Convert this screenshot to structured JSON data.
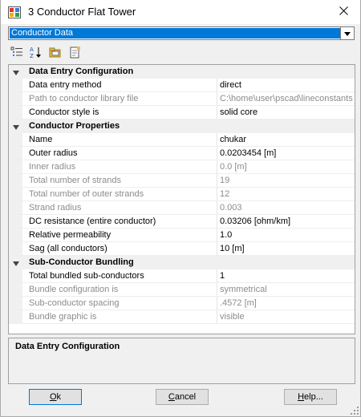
{
  "window": {
    "title": "3 Conductor Flat Tower",
    "colors": {
      "selection": "#0078d7",
      "category_bg": "#f0f0f0",
      "disabled_text": "#8c8c8c"
    }
  },
  "dropdown": {
    "selected": "Conductor Data"
  },
  "toolbar": {
    "buttons": [
      {
        "name": "categorized-view",
        "icon": "categorized-icon"
      },
      {
        "name": "alphabetical-view",
        "icon": "sort-az-icon"
      },
      {
        "name": "property-pages",
        "icon": "folder-icon"
      },
      {
        "name": "notes",
        "icon": "document-icon"
      }
    ]
  },
  "grid": {
    "categories": [
      {
        "label": "Data Entry Configuration",
        "rows": [
          {
            "name": "Data entry method",
            "value": "direct",
            "enabled": true
          },
          {
            "name": "Path to conductor library file",
            "value": "C:\\home\\user\\pscad\\lineconstants\\",
            "enabled": false
          },
          {
            "name": "Conductor style is",
            "value": "solid core",
            "enabled": true
          }
        ]
      },
      {
        "label": "Conductor Properties",
        "rows": [
          {
            "name": "Name",
            "value": "chukar",
            "enabled": true
          },
          {
            "name": "Outer radius",
            "value": "0.0203454 [m]",
            "enabled": true
          },
          {
            "name": "Inner radius",
            "value": "0.0 [m]",
            "enabled": false
          },
          {
            "name": "Total number of strands",
            "value": "19",
            "enabled": false
          },
          {
            "name": "Total number of outer strands",
            "value": "12",
            "enabled": false
          },
          {
            "name": "Strand radius",
            "value": "0.003",
            "enabled": false
          },
          {
            "name": "DC resistance (entire conductor)",
            "value": "0.03206 [ohm/km]",
            "enabled": true
          },
          {
            "name": "Relative permeability",
            "value": "1.0",
            "enabled": true
          },
          {
            "name": "Sag (all conductors)",
            "value": "10 [m]",
            "enabled": true
          }
        ]
      },
      {
        "label": "Sub-Conductor Bundling",
        "rows": [
          {
            "name": "Total bundled sub-conductors",
            "value": "1",
            "enabled": true
          },
          {
            "name": "Bundle configuration is",
            "value": "symmetrical",
            "enabled": false
          },
          {
            "name": "Sub-conductor spacing",
            "value": ".4572 [m]",
            "enabled": false
          },
          {
            "name": "Bundle graphic is",
            "value": "visible",
            "enabled": false
          }
        ]
      }
    ]
  },
  "description": {
    "title": "Data Entry Configuration"
  },
  "buttons": {
    "ok": {
      "mnemonic": "O",
      "rest": "k"
    },
    "cancel": {
      "mnemonic": "C",
      "rest": "ancel"
    },
    "help": {
      "mnemonic": "H",
      "rest": "elp..."
    }
  }
}
